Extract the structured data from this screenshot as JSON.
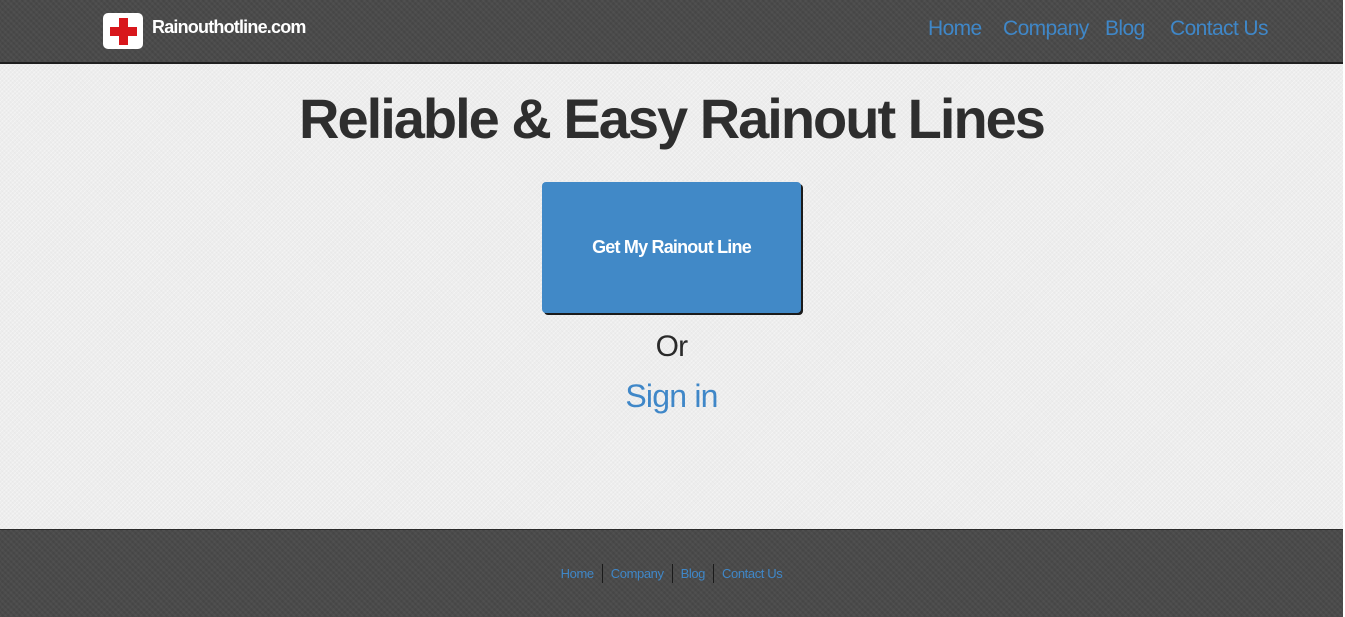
{
  "colors": {
    "header_bg": "#4a4a4a",
    "main_bg": "#ededed",
    "accent": "#4189c7",
    "link": "#3f87c8",
    "logo_cross": "#d8171c",
    "title_text": "#2e2e2e"
  },
  "header": {
    "logo_icon": "red-cross-icon",
    "brand": "Rainouthotline.com",
    "nav": {
      "home": "Home",
      "company": "Company",
      "blog": "Blog",
      "contact": "Contact Us"
    }
  },
  "main": {
    "title": "Reliable & Easy Rainout Lines",
    "cta_label": "Get My Rainout Line",
    "or_text": "Or",
    "signin_label": "Sign in"
  },
  "footer": {
    "nav": {
      "home": "Home",
      "company": "Company",
      "blog": "Blog",
      "contact": "Contact Us"
    }
  }
}
